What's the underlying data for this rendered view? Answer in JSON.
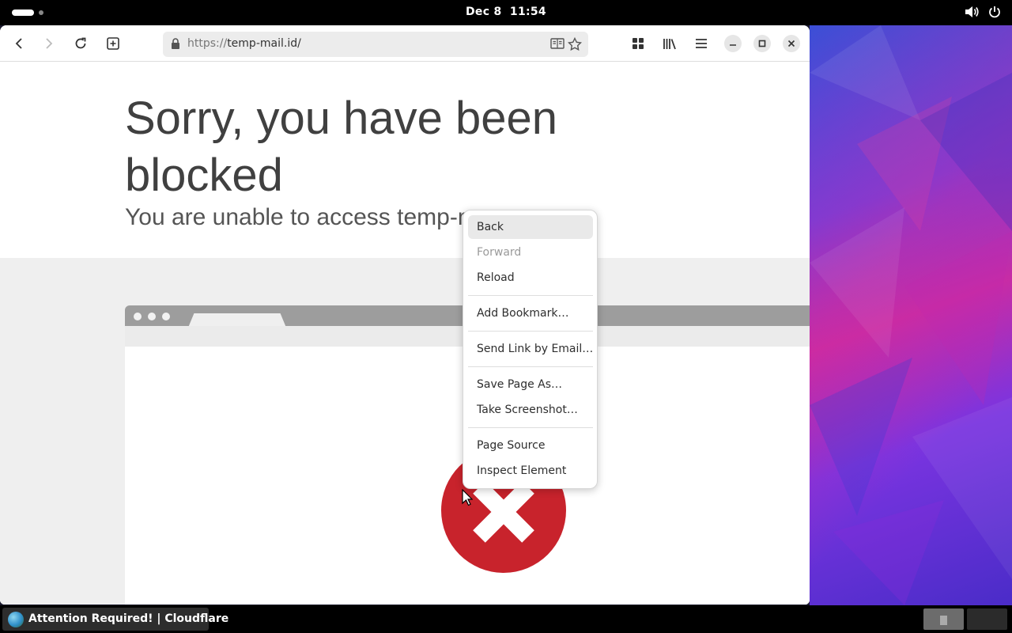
{
  "topbar": {
    "clock_date": "Dec 8",
    "clock_time": "11:54",
    "icons": [
      "activities-icon",
      "volume-icon",
      "power-icon"
    ]
  },
  "browser": {
    "url_protocol": "https://",
    "url_host": "temp-mail.id/",
    "toolbar_icons": [
      "back-icon",
      "forward-icon",
      "reload-icon",
      "new-tab-icon",
      "reader-view-icon",
      "bookmark-star-icon",
      "apps-grid-icon",
      "library-icon",
      "menu-icon",
      "minimize-icon",
      "maximize-icon",
      "close-icon"
    ]
  },
  "page": {
    "headline": "Sorry, you have been blocked",
    "subline": "You are unable to access temp-m"
  },
  "context_menu": {
    "items": [
      {
        "label": "Back",
        "state": "hover"
      },
      {
        "label": "Forward",
        "state": "disabled"
      },
      {
        "label": "Reload",
        "state": "normal"
      },
      {
        "label": "Add Bookmark…",
        "state": "normal"
      },
      {
        "label": "Send Link by Email…",
        "state": "normal"
      },
      {
        "label": "Save Page As…",
        "state": "normal"
      },
      {
        "label": "Take Screenshot…",
        "state": "normal"
      },
      {
        "label": "Page Source",
        "state": "normal"
      },
      {
        "label": "Inspect Element",
        "state": "normal"
      }
    ]
  },
  "taskbar": {
    "window_title": "Attention Required! | Cloudflare"
  },
  "colors": {
    "error_red": "#c8232c",
    "hover_bg": "#e9e9e9",
    "topbar_bg": "#000000"
  }
}
